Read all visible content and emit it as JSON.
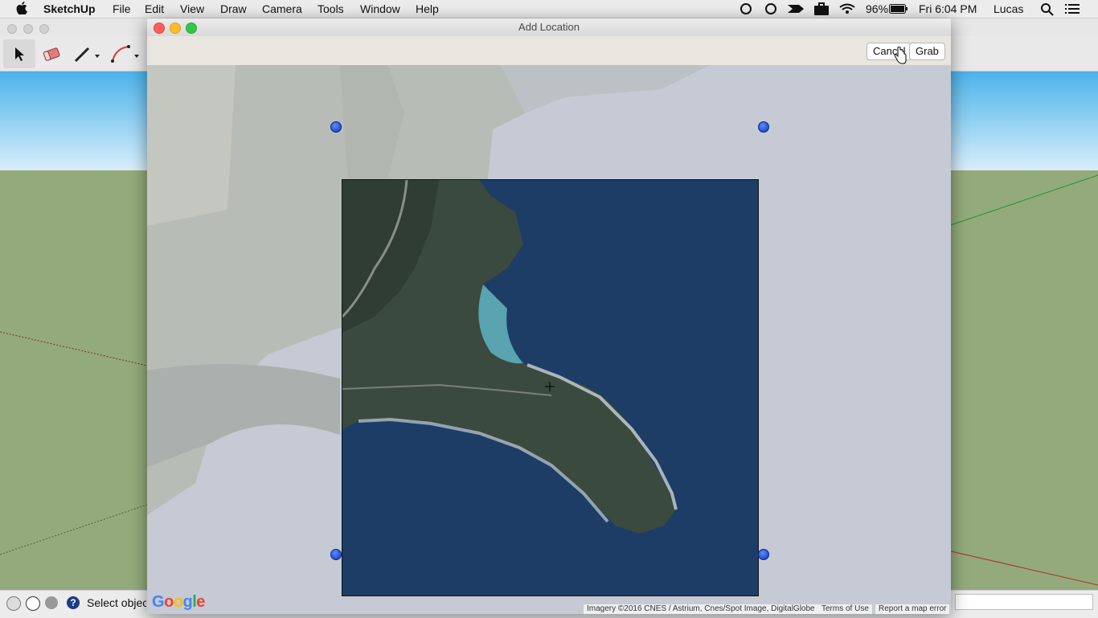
{
  "menubar": {
    "app": "SketchUp",
    "items": [
      "File",
      "Edit",
      "View",
      "Draw",
      "Camera",
      "Tools",
      "Window",
      "Help"
    ],
    "battery": "96%",
    "clock": "Fri 6:04 PM",
    "user": "Lucas"
  },
  "status": {
    "text": "Select objec"
  },
  "dialog": {
    "title": "Add Location",
    "cancel_label": "Cancel",
    "grab_label": "Grab",
    "logo": "Google",
    "attribution": "Imagery ©2016 CNES / Astrium, Cnes/Spot Image, DigitalGlobe",
    "terms": "Terms of Use",
    "report": "Report a map error"
  },
  "colors": {
    "sky": "#4ab2ea",
    "ground": "#93ab7c",
    "water": "#1d3d66",
    "handle": "#1e4fe0"
  },
  "icons": [
    "apple-icon",
    "select-icon",
    "eraser-icon",
    "pencil-icon",
    "arc-icon",
    "search-icon",
    "menu-icon",
    "battery-icon",
    "wifi-icon",
    "briefcase-icon"
  ]
}
